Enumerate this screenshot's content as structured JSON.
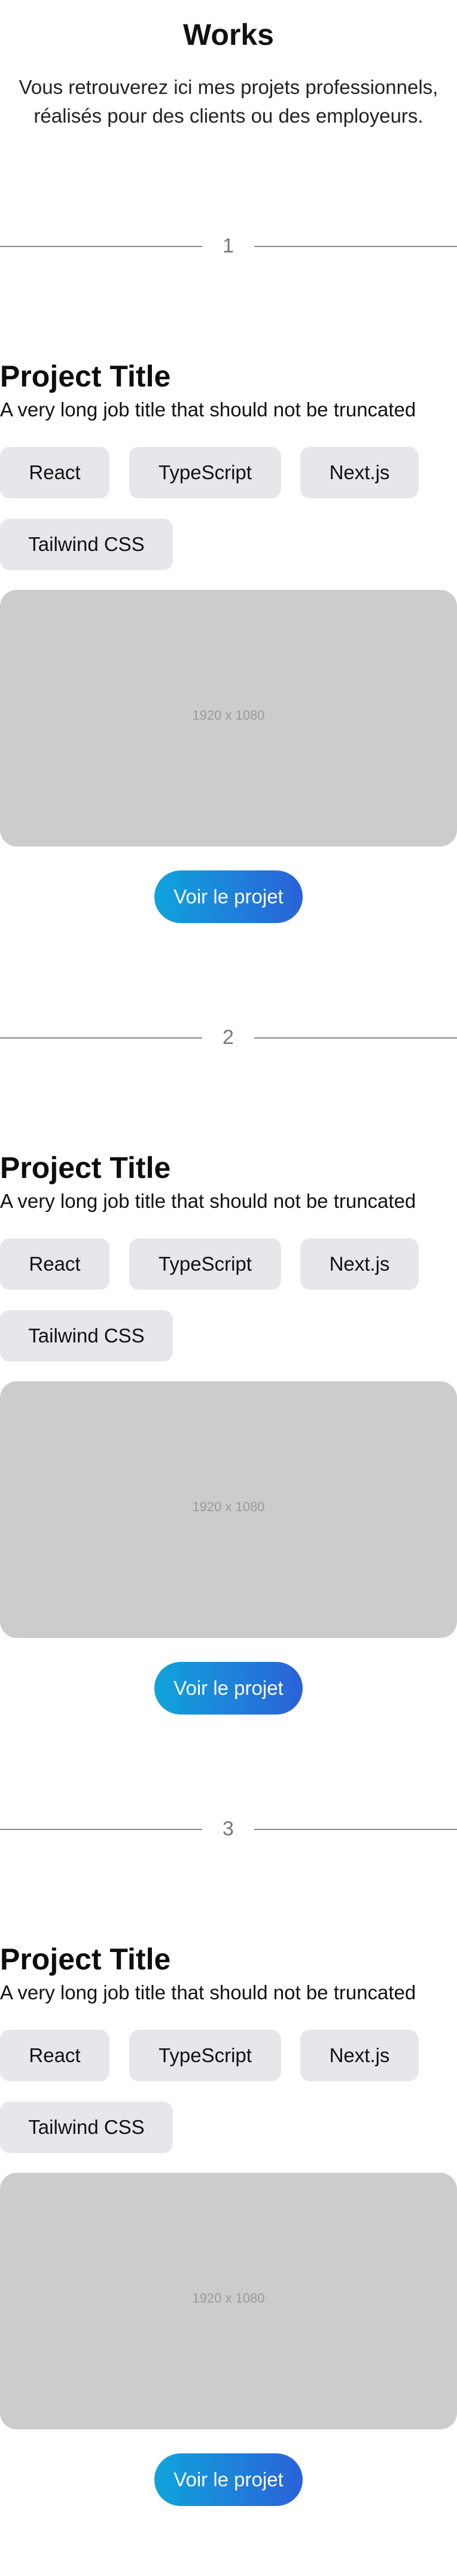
{
  "header": {
    "title": "Works",
    "intro_line_1": "Vous retrouverez ici mes projets professionnels,",
    "intro_line_2": "réalisés pour des clients ou des employeurs."
  },
  "projects": [
    {
      "number": "1",
      "title": "Project Title",
      "subtitle": "A very long job title that should not be truncated",
      "tags": [
        "React",
        "TypeScript",
        "Next.js",
        "Tailwind CSS"
      ],
      "image_caption": "1920 x 1080",
      "button_label": "Voir le projet"
    },
    {
      "number": "2",
      "title": "Project Title",
      "subtitle": "A very long job title that should not be truncated",
      "tags": [
        "React",
        "TypeScript",
        "Next.js",
        "Tailwind CSS"
      ],
      "image_caption": "1920 x 1080",
      "button_label": "Voir le projet"
    },
    {
      "number": "3",
      "title": "Project Title",
      "subtitle": "A very long job title that should not be truncated",
      "tags": [
        "React",
        "TypeScript",
        "Next.js",
        "Tailwind CSS"
      ],
      "image_caption": "1920 x 1080",
      "button_label": "Voir le projet"
    }
  ],
  "colors": {
    "button_gradient_start": "#10a4dc",
    "button_gradient_end": "#2a62d8",
    "tag_background": "#e6e7ea",
    "image_placeholder": "#cccccc",
    "divider": "#8a8a8a"
  }
}
